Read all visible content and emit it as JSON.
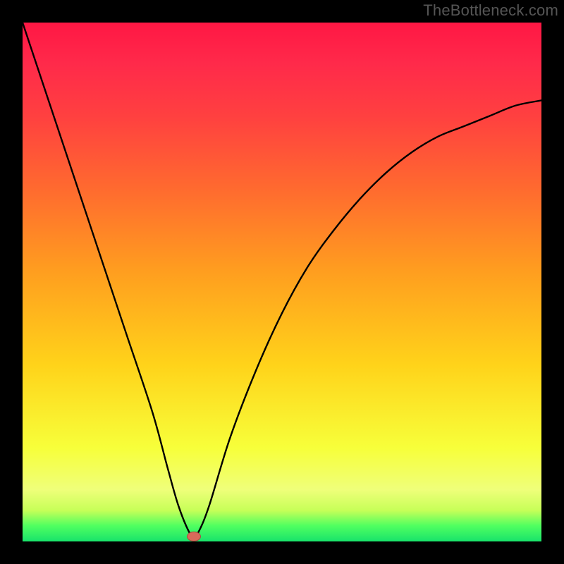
{
  "attribution": "TheBottleneck.com",
  "colors": {
    "frame": "#000000",
    "curve": "#000000",
    "marker_fill": "#d96a5a",
    "marker_stroke": "#a94a3f",
    "gradient_stops": [
      "#ff1744",
      "#ff2a4a",
      "#ff4040",
      "#ff6a2f",
      "#ff9e1f",
      "#ffd31a",
      "#f7ff3a",
      "#efff7a",
      "#c7ff58",
      "#4fff60",
      "#18e36b"
    ]
  },
  "chart_data": {
    "type": "line",
    "title": "",
    "xlabel": "",
    "ylabel": "",
    "xlim": [
      0,
      100
    ],
    "ylim": [
      0,
      100
    ],
    "grid": false,
    "legend": false,
    "annotations": [
      "TheBottleneck.com"
    ],
    "series": [
      {
        "name": "bottleneck-curve",
        "x": [
          0,
          5,
          10,
          15,
          20,
          25,
          28,
          30,
          32,
          33,
          34,
          36,
          40,
          45,
          50,
          55,
          60,
          65,
          70,
          75,
          80,
          85,
          90,
          95,
          100
        ],
        "y": [
          100,
          85,
          70,
          55,
          40,
          25,
          14,
          7,
          2,
          1,
          2,
          7,
          20,
          33,
          44,
          53,
          60,
          66,
          71,
          75,
          78,
          80,
          82,
          84,
          85
        ]
      }
    ],
    "marker": {
      "x": 33,
      "y": 1
    }
  }
}
